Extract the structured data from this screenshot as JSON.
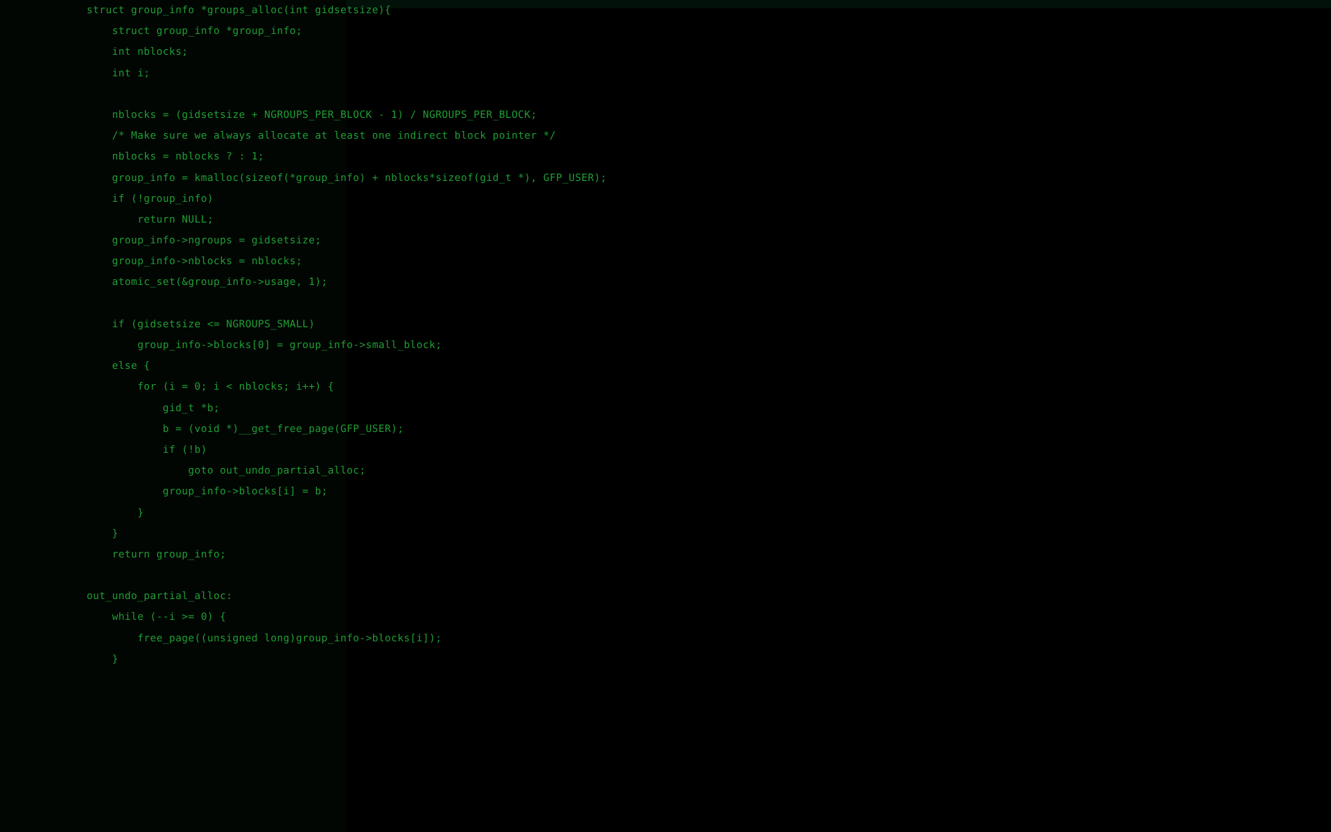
{
  "document": {
    "kind": "source-code-listing",
    "language": "C",
    "function_name": "groups_alloc",
    "theme": {
      "background": "#000000",
      "foreground": "#1f9e33",
      "panel_tint_top": "#02120a",
      "panel_tint_left": "#020603"
    },
    "typography": {
      "indent_spaces": 4,
      "tab_width": 4
    }
  },
  "code": {
    "lines": [
      "struct group_info *groups_alloc(int gidsetsize){",
      "    struct group_info *group_info;",
      "    int nblocks;",
      "    int i;",
      "",
      "    nblocks = (gidsetsize + NGROUPS_PER_BLOCK - 1) / NGROUPS_PER_BLOCK;",
      "    /* Make sure we always allocate at least one indirect block pointer */",
      "    nblocks = nblocks ? : 1;",
      "    group_info = kmalloc(sizeof(*group_info) + nblocks*sizeof(gid_t *), GFP_USER);",
      "    if (!group_info)",
      "        return NULL;",
      "    group_info->ngroups = gidsetsize;",
      "    group_info->nblocks = nblocks;",
      "    atomic_set(&group_info->usage, 1);",
      "",
      "    if (gidsetsize <= NGROUPS_SMALL)",
      "        group_info->blocks[0] = group_info->small_block;",
      "    else {",
      "        for (i = 0; i < nblocks; i++) {",
      "            gid_t *b;",
      "            b = (void *)__get_free_page(GFP_USER);",
      "            if (!b)",
      "                goto out_undo_partial_alloc;",
      "            group_info->blocks[i] = b;",
      "        }",
      "    }",
      "    return group_info;",
      "",
      "out_undo_partial_alloc:",
      "    while (--i >= 0) {",
      "        free_page((unsigned long)group_info->blocks[i]);",
      "    }"
    ]
  }
}
